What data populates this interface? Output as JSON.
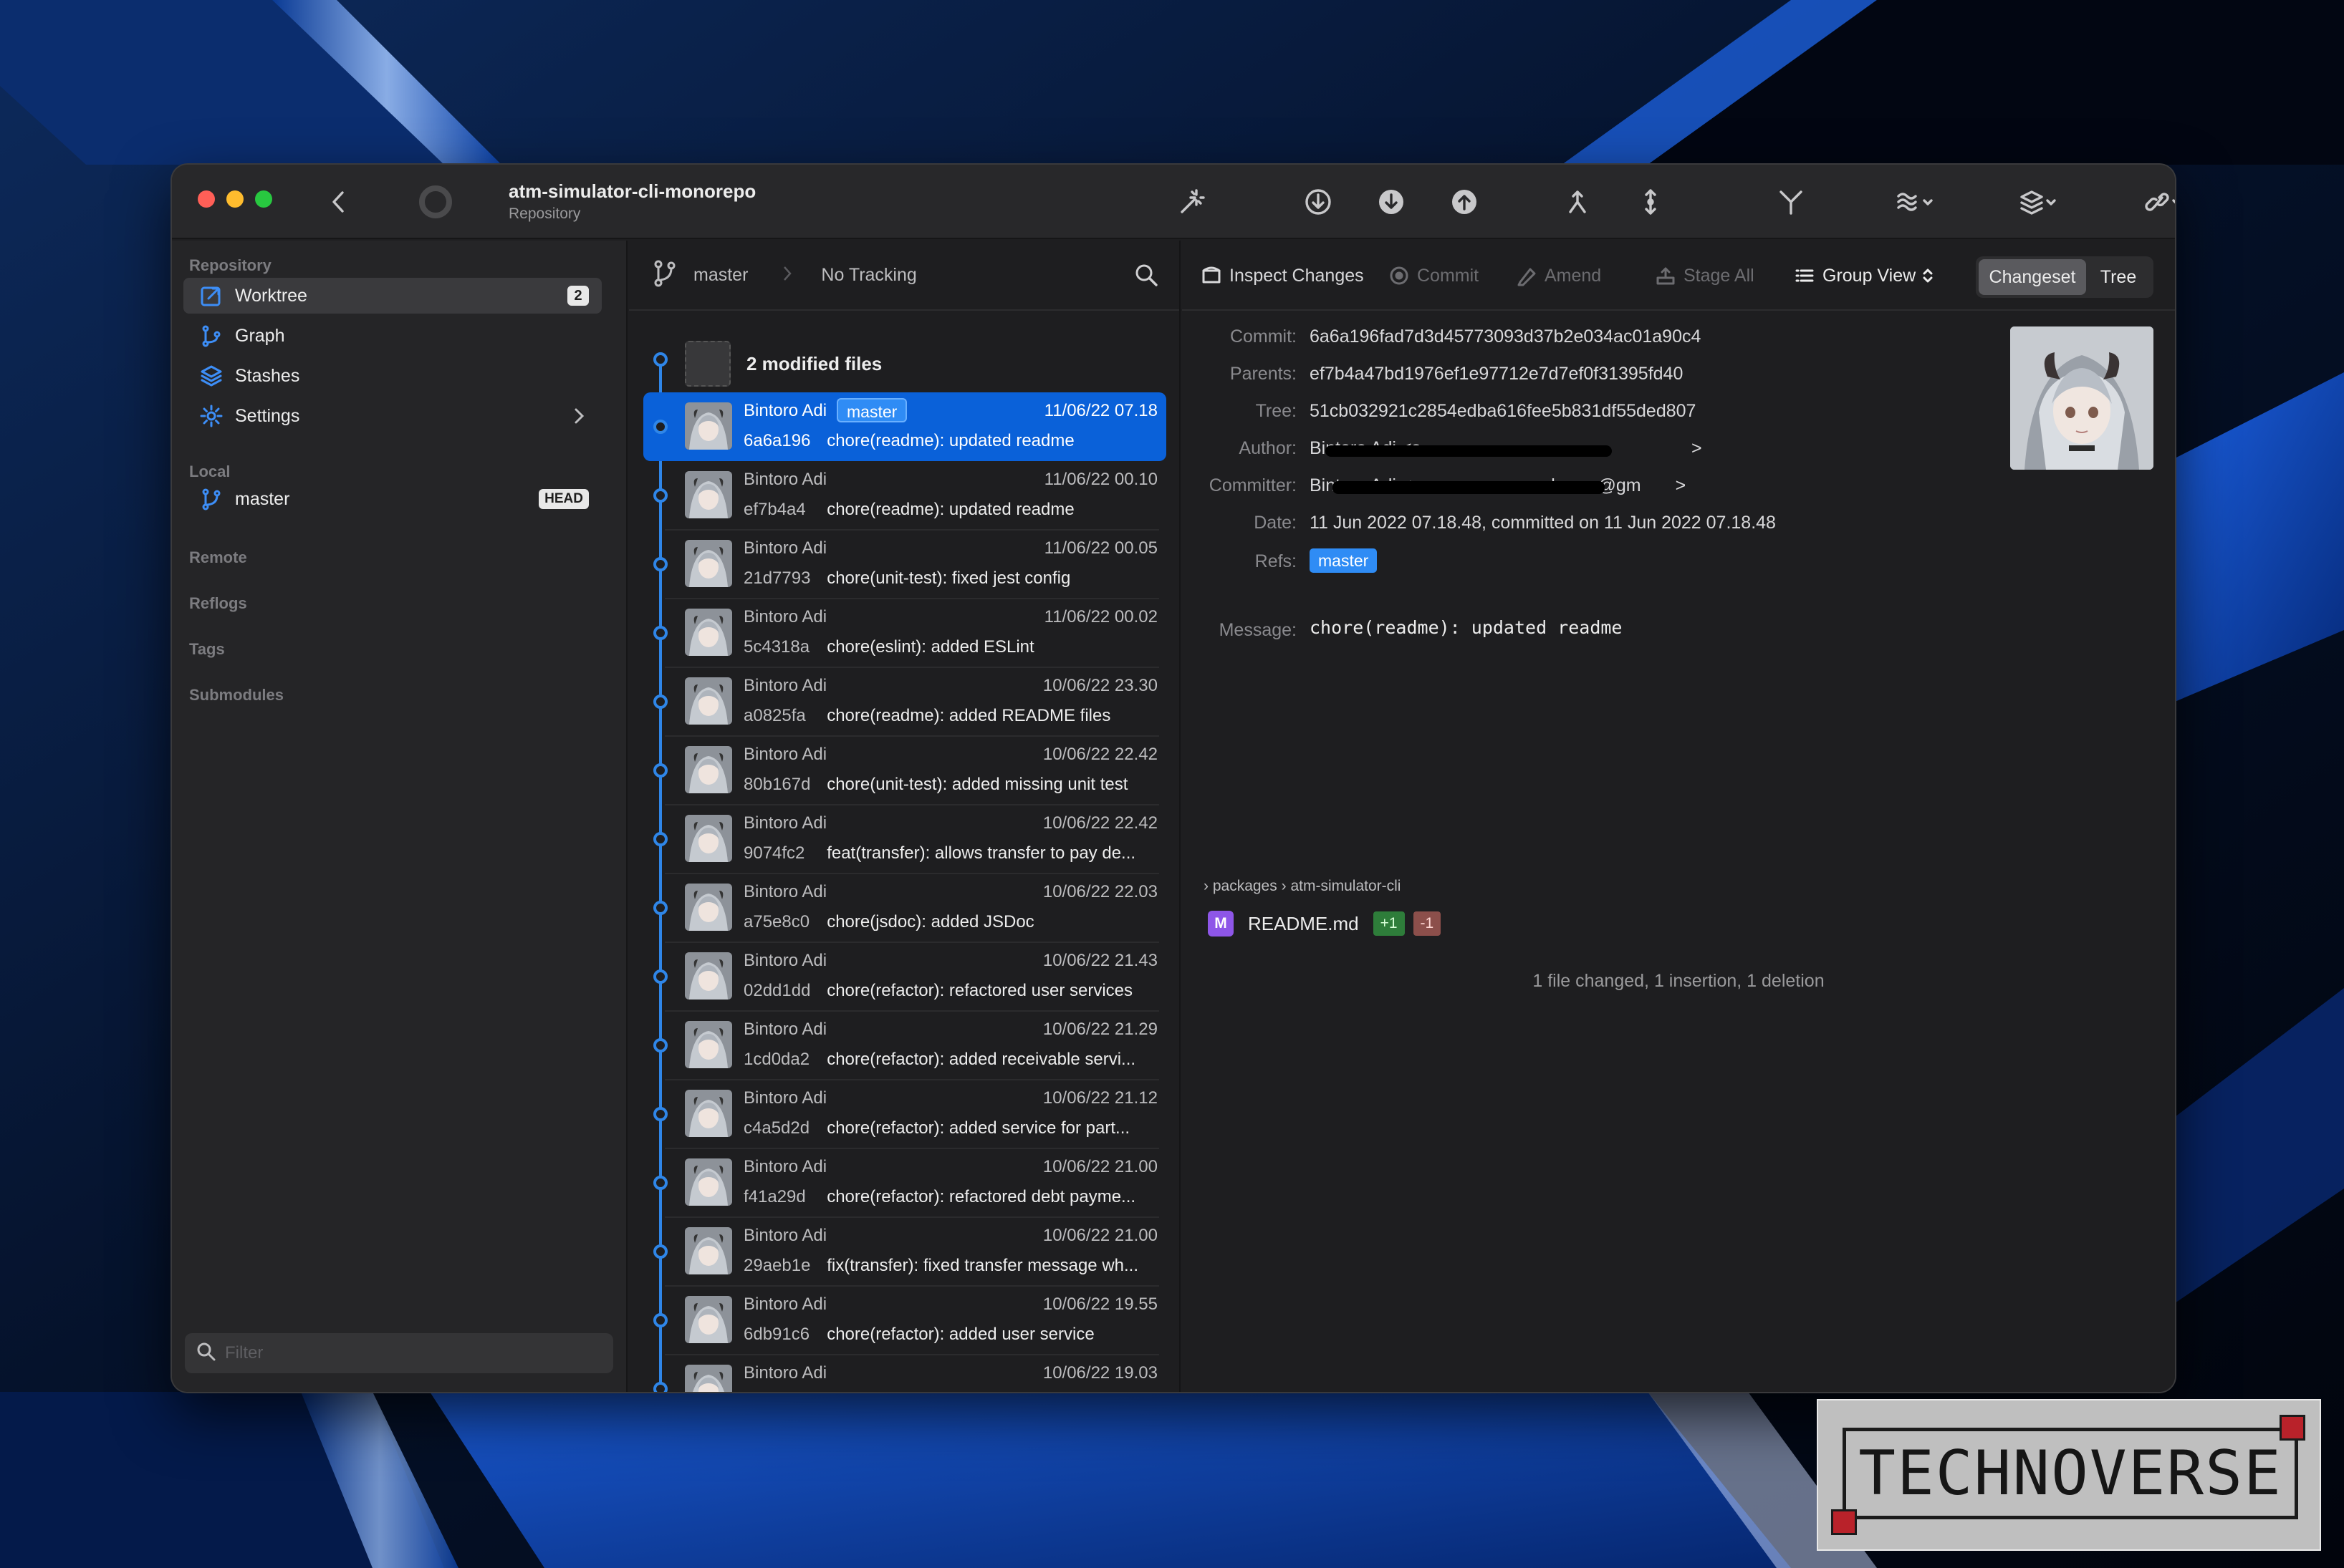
{
  "window": {
    "repo_name": "atm-simulator-cli-monorepo",
    "repo_subtitle": "Repository"
  },
  "toolbar_icons": [
    "back-icon",
    "status-icon",
    "magic-icon",
    "fetch-icon",
    "pull-icon",
    "push-icon",
    "merge-icon",
    "rebase-icon",
    "branch-icon",
    "stash-icon",
    "stack-icon",
    "link-icon",
    "refresh-icon"
  ],
  "sidebar": {
    "repository_header": "Repository",
    "items": [
      {
        "label": "Worktree",
        "badge": "2",
        "icon": "worktree-icon"
      },
      {
        "label": "Graph",
        "icon": "graph-icon"
      },
      {
        "label": "Stashes",
        "icon": "stashes-icon"
      },
      {
        "label": "Settings",
        "icon": "settings-icon"
      }
    ],
    "local_header": "Local",
    "local_branch": {
      "label": "master",
      "badge": "HEAD"
    },
    "sections": [
      "Remote",
      "Reflogs",
      "Tags",
      "Submodules"
    ],
    "filter_placeholder": "Filter"
  },
  "list": {
    "branch": "master",
    "tracking": "No Tracking",
    "modified_label": "2 modified files",
    "commits": [
      {
        "author": "Bintoro Adi",
        "date": "11/06/22 07.18",
        "sha": "6a6a196",
        "message": "chore(readme): updated readme",
        "ref": "master",
        "selected": true
      },
      {
        "author": "Bintoro Adi",
        "date": "11/06/22 00.10",
        "sha": "ef7b4a4",
        "message": "chore(readme): updated readme"
      },
      {
        "author": "Bintoro Adi",
        "date": "11/06/22 00.05",
        "sha": "21d7793",
        "message": "chore(unit-test): fixed jest config"
      },
      {
        "author": "Bintoro Adi",
        "date": "11/06/22 00.02",
        "sha": "5c4318a",
        "message": "chore(eslint): added ESLint"
      },
      {
        "author": "Bintoro Adi",
        "date": "10/06/22 23.30",
        "sha": "a0825fa",
        "message": "chore(readme): added README files"
      },
      {
        "author": "Bintoro Adi",
        "date": "10/06/22 22.42",
        "sha": "80b167d",
        "message": "chore(unit-test): added missing unit test"
      },
      {
        "author": "Bintoro Adi",
        "date": "10/06/22 22.42",
        "sha": "9074fc2",
        "message": "feat(transfer): allows transfer to pay de..."
      },
      {
        "author": "Bintoro Adi",
        "date": "10/06/22 22.03",
        "sha": "a75e8c0",
        "message": "chore(jsdoc): added JSDoc"
      },
      {
        "author": "Bintoro Adi",
        "date": "10/06/22 21.43",
        "sha": "02dd1dd",
        "message": "chore(refactor): refactored user services"
      },
      {
        "author": "Bintoro Adi",
        "date": "10/06/22 21.29",
        "sha": "1cd0da2",
        "message": "chore(refactor): added receivable servi..."
      },
      {
        "author": "Bintoro Adi",
        "date": "10/06/22 21.12",
        "sha": "c4a5d2d",
        "message": "chore(refactor): added service for part..."
      },
      {
        "author": "Bintoro Adi",
        "date": "10/06/22 21.00",
        "sha": "f41a29d",
        "message": "chore(refactor): refactored debt payme..."
      },
      {
        "author": "Bintoro Adi",
        "date": "10/06/22 21.00",
        "sha": "29aeb1e",
        "message": "fix(transfer): fixed transfer message wh..."
      },
      {
        "author": "Bintoro Adi",
        "date": "10/06/22 19.55",
        "sha": "6db91c6",
        "message": "chore(refactor): added user service"
      },
      {
        "author": "Bintoro Adi",
        "date": "10/06/22 19.03",
        "sha": "",
        "message": ""
      }
    ]
  },
  "detail_toolbar": {
    "inspect": "Inspect Changes",
    "commit": "Commit",
    "amend": "Amend",
    "stage_all": "Stage All",
    "group_view": "Group View",
    "seg_changeset": "Changeset",
    "seg_tree": "Tree"
  },
  "detail": {
    "labels": {
      "commit": "Commit:",
      "parents": "Parents:",
      "tree": "Tree:",
      "author": "Author:",
      "committer": "Committer:",
      "date": "Date:",
      "refs": "Refs:",
      "message": "Message:"
    },
    "commit": "6a6a196fad7d3d45773093d37b2e034ac01a90c4",
    "parents": "ef7b4a47bd1976ef1e97712e7d7ef0f31395fd40",
    "tree": "51cb032921c2854edba616fee5b831df55ded807",
    "author": "Bintoro Adi <s",
    "author_tail": ">",
    "committer": "Bintoro Adi <s",
    "committer_tail": "arkness@gm",
    "committer_end": ">",
    "date": "11 Jun 2022 07.18.48, committed on 11 Jun 2022 07.18.48",
    "ref": "master",
    "message": "chore(readme): updated readme"
  },
  "changes": {
    "path_root": "packages",
    "path_leaf": "atm-simulator-cli",
    "file_status": "M",
    "file_name": "README.md",
    "insertions": "+1",
    "deletions": "-1",
    "summary": "1 file changed, 1 insertion, 1 deletion"
  },
  "watermark": "TECHNOVERSE"
}
